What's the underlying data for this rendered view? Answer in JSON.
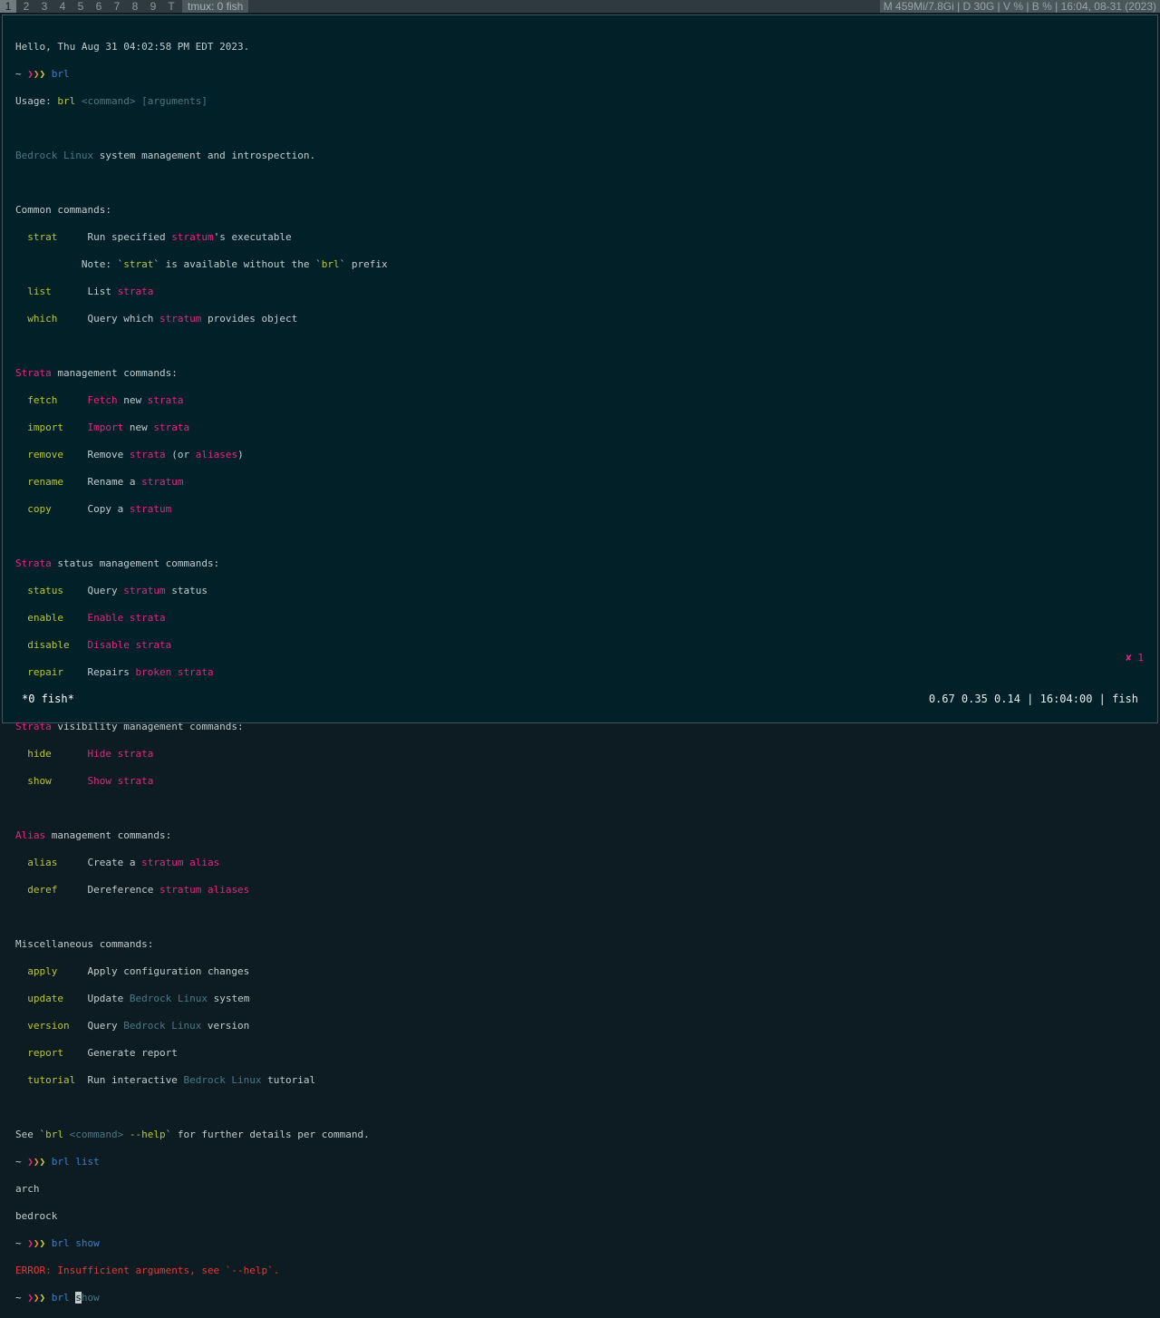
{
  "topbar": {
    "workspaces": [
      "1",
      "2",
      "3",
      "4",
      "5",
      "6",
      "7",
      "8",
      "9",
      "T"
    ],
    "window_title": "tmux: 0 fish",
    "status": "M 459Mi/7.8Gi | D 30G | V % | B % | 16:04, 08-31 (2023)"
  },
  "prompt": {
    "tilde": "~",
    "arrows": "❯❯❯"
  },
  "greeting": "Hello, Thu Aug 31 04:02:58 PM EDT 2023.",
  "cmd1": "brl",
  "usage": {
    "label": "Usage:",
    "cmd": "brl",
    "args": "<command> [arguments]"
  },
  "description": "Bedrock Linux system management and introspection.",
  "sections": {
    "common": {
      "heading": "Common commands:"
    },
    "strata_mgmt": {
      "heading_a": "Strata",
      "heading_b": "management commands:"
    },
    "strata_status": {
      "heading_a": "Strata",
      "heading_b": "status management commands:"
    },
    "strata_vis": {
      "heading_a": "Strata",
      "heading_b": "visibility management commands:"
    },
    "alias_mgmt": {
      "heading_a": "Alias",
      "heading_b": "management commands:"
    },
    "misc": {
      "heading": "Miscellaneous commands:"
    }
  },
  "commands": {
    "strat": "strat",
    "list": "list",
    "which": "which",
    "fetch": "fetch",
    "import": "import",
    "remove": "remove",
    "rename": "rename",
    "copy": "copy",
    "status": "status",
    "enable": "enable",
    "disable": "disable",
    "repair": "repair",
    "hide": "hide",
    "show": "show",
    "alias": "alias",
    "deref": "deref",
    "apply": "apply",
    "update": "update",
    "version": "version",
    "report": "report",
    "tutorial": "tutorial"
  },
  "see_help": "See `brl <command> --help` for further details per command.",
  "cmd2": "brl list",
  "list_output": [
    "arch",
    "bedrock"
  ],
  "cmd3": "brl show",
  "error": {
    "label": "ERROR:",
    "text": "Insufficient arguments, see `--help`."
  },
  "current_input": {
    "cmd": "brl",
    "cursor_char": "s",
    "suggestion": "how"
  },
  "error_marker": "✘ 1",
  "tmux": {
    "left": "*0 fish*",
    "right": "0.67 0.35 0.14 | 16:04:00 | fish"
  }
}
